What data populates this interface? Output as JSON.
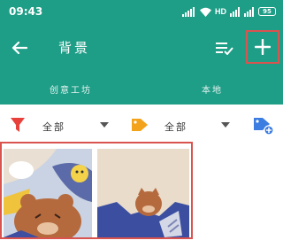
{
  "status_bar": {
    "time": "09:43",
    "signal_text": "HD",
    "battery_text": "95"
  },
  "toolbar": {
    "title": "背景",
    "back_icon": "arrow-left-icon",
    "sort_icon": "playlist-check-icon",
    "add_icon": "plus-icon"
  },
  "tabs": [
    {
      "label": "创意工坊"
    },
    {
      "label": "本地"
    }
  ],
  "filters": {
    "filter_label": "全部",
    "tag_label": "全部"
  },
  "colors": {
    "primary": "#1f9e87",
    "filter_icon": "#e8403a",
    "tag_icon": "#f3a21b",
    "tag_add_icon": "#3b7de0",
    "highlight": "#d9534f"
  },
  "wallpapers": [
    {
      "name": "cartoon-bear-wallpaper"
    },
    {
      "name": "cat-wallpaper"
    }
  ]
}
